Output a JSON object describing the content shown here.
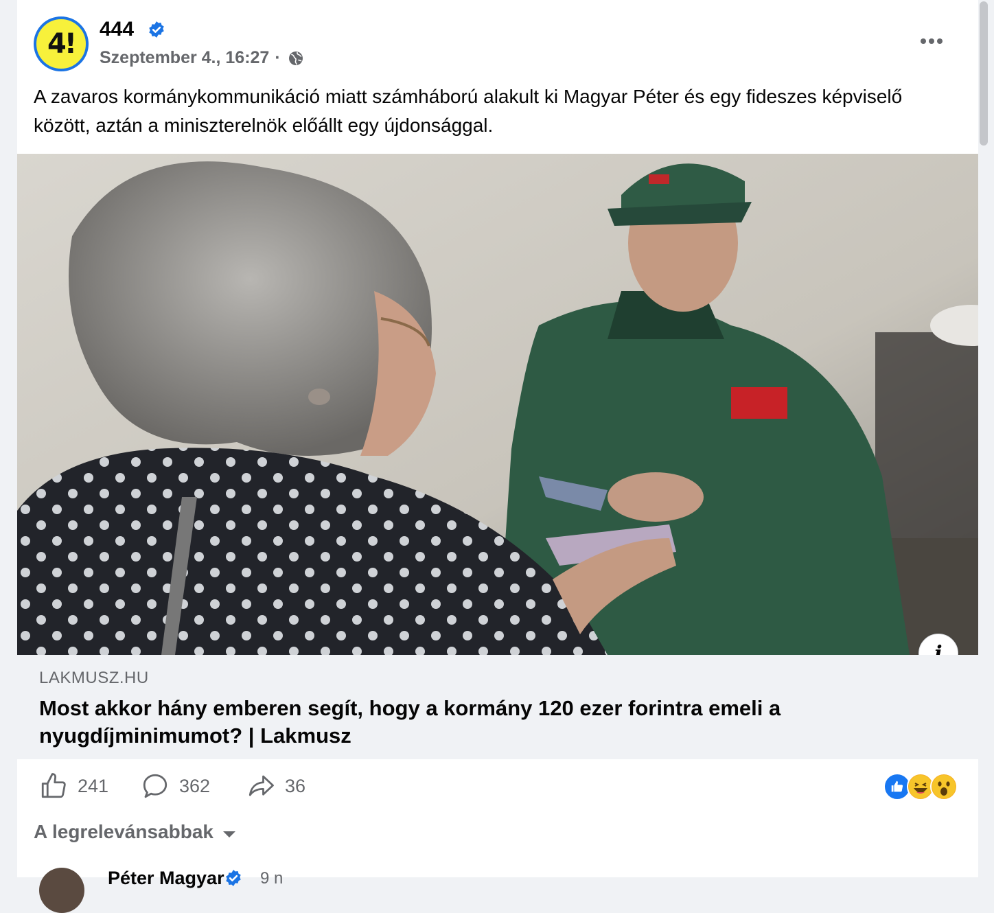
{
  "post": {
    "page_name": "444",
    "timestamp": "Szeptember 4., 16:27",
    "separator": "·",
    "avatar_text": "4!",
    "text": "A zavaros kormánykommunikáció miatt számháború alakult ki Magyar Péter és egy fideszes képviselő között, aztán a miniszterelnök előállt egy újdonsággal."
  },
  "link": {
    "domain": "LAKMUSZ.HU",
    "title": "Most akkor hány emberen segít, hogy a kormány 120 ezer forintra emeli a nyugdíjminimumot? | Lakmusz",
    "info_icon_text": "i"
  },
  "actions": {
    "likes": "241",
    "comments": "362",
    "shares": "36"
  },
  "reactions": [
    "like-icon",
    "haha-icon",
    "wow-icon"
  ],
  "sort": {
    "label": "A legrelevánsabbak"
  },
  "comment": {
    "name": "Péter Magyar",
    "time": "9 n"
  },
  "colors": {
    "accent": "#1b74e4",
    "muted": "#65676b",
    "link_bg": "#f0f2f5",
    "avatar_yellow": "#f7f13b"
  }
}
